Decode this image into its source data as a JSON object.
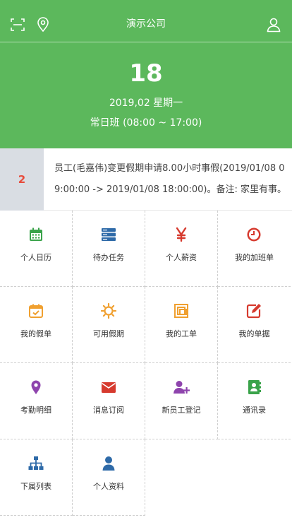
{
  "header": {
    "title": "演示公司",
    "scan_icon": "scan-icon",
    "location_icon": "location-pin-icon",
    "profile_icon": "user-icon",
    "color": "#5cb85c"
  },
  "today": {
    "day": "18",
    "date_line": "2019,02 星期一",
    "shift": "常日班 (08:00 ~ 17:00)"
  },
  "notice": {
    "count": "2",
    "text": "员工(毛嘉伟)变更假期申请8.00小时事假(2019/01/08 09:00:00 -> 2019/01/08 18:00:00)。备注: 家里有事。"
  },
  "menu": [
    {
      "label": "个人日历",
      "icon": "calendar-icon",
      "color": "#3aa34a"
    },
    {
      "label": "待办任务",
      "icon": "server-stack-icon",
      "color": "#2e6aa8"
    },
    {
      "label": "个人薪资",
      "icon": "yen-icon",
      "color": "#d63a2e"
    },
    {
      "label": "我的加班单",
      "icon": "clock-icon",
      "color": "#d63a2e"
    },
    {
      "label": "我的假单",
      "icon": "calendar-check-icon",
      "color": "#f0a030"
    },
    {
      "label": "可用假期",
      "icon": "sun-icon",
      "color": "#f0a030"
    },
    {
      "label": "我的工单",
      "icon": "clone-icon",
      "color": "#f0a030"
    },
    {
      "label": "我的单据",
      "icon": "edit-icon",
      "color": "#d63a2e"
    },
    {
      "label": "考勤明细",
      "icon": "map-marker-icon",
      "color": "#8e44ad"
    },
    {
      "label": "消息订阅",
      "icon": "envelope-icon",
      "color": "#d63a2e"
    },
    {
      "label": "新员工登记",
      "icon": "user-plus-icon",
      "color": "#8e44ad"
    },
    {
      "label": "通讯录",
      "icon": "address-book-icon",
      "color": "#3aa34a"
    },
    {
      "label": "下属列表",
      "icon": "org-chart-icon",
      "color": "#2e6aa8"
    },
    {
      "label": "个人资料",
      "icon": "user-solid-icon",
      "color": "#2e6aa8"
    }
  ]
}
